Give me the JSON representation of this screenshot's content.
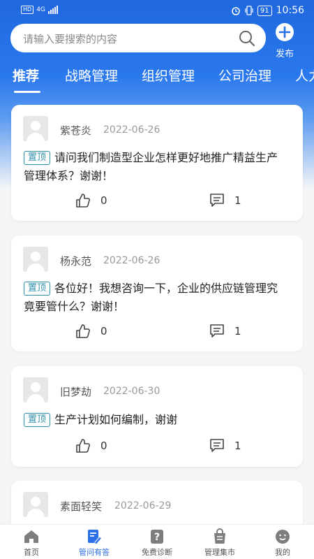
{
  "status_bar": {
    "network": "4G",
    "hd": "HD",
    "battery": "91",
    "time": "10:56"
  },
  "search": {
    "placeholder": "请输入要搜索的内容"
  },
  "publish": {
    "label": "发布"
  },
  "tabs": [
    {
      "label": "推荐",
      "active": true
    },
    {
      "label": "战略管理"
    },
    {
      "label": "组织管理"
    },
    {
      "label": "公司治理"
    },
    {
      "label": "人力"
    }
  ],
  "posts": [
    {
      "user": "紫苍炎",
      "date": "2022-06-26",
      "badge": "置顶",
      "text": "请问我们制造型企业怎样更好地推广精益生产管理体系？谢谢！",
      "likes": "0",
      "comments": "1"
    },
    {
      "user": "杨永范",
      "date": "2022-06-26",
      "badge": "置顶",
      "text": "各位好！我想咨询一下，企业的供应链管理究竟要管什么？谢谢！",
      "likes": "0",
      "comments": "1"
    },
    {
      "user": "旧梦劫",
      "date": "2022-06-30",
      "badge": "置顶",
      "text": "生产计划如何编制，谢谢",
      "likes": "0",
      "comments": "1"
    },
    {
      "user": "素面轻笑",
      "date": "2022-06-29"
    }
  ],
  "bottom_nav": [
    {
      "label": "首页",
      "icon": "home-icon"
    },
    {
      "label": "管问有答",
      "icon": "qa-edit-icon",
      "active": true
    },
    {
      "label": "免费诊断",
      "icon": "question-icon"
    },
    {
      "label": "管理集市",
      "icon": "bag-icon"
    },
    {
      "label": "我的",
      "icon": "profile-icon"
    }
  ],
  "colors": {
    "brand": "#2a6fe8",
    "badge": "#2d8fa8",
    "header": "#1f67df"
  }
}
